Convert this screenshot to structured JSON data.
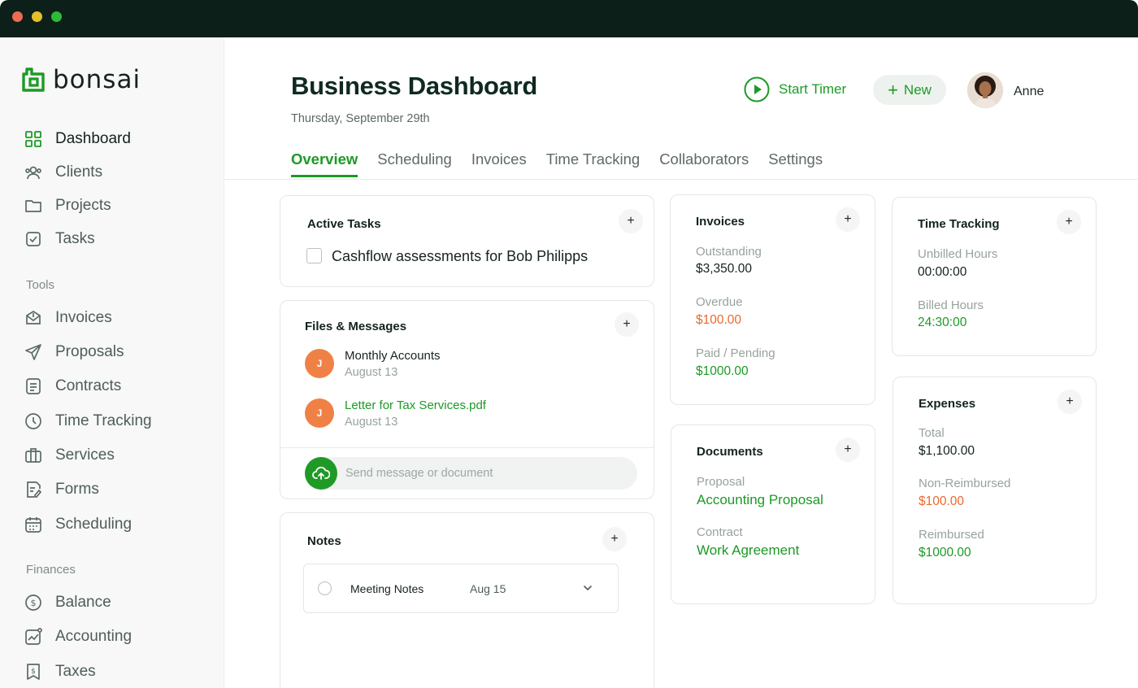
{
  "app": {
    "logo_text": "bonsai"
  },
  "sidebar": {
    "main_items": [
      {
        "label": "Dashboard",
        "icon": "grid-icon",
        "active": true
      },
      {
        "label": "Clients",
        "icon": "users-icon"
      },
      {
        "label": "Projects",
        "icon": "folder-icon"
      },
      {
        "label": "Tasks",
        "icon": "check-square-icon"
      }
    ],
    "tools_label": "Tools",
    "tools_items": [
      {
        "label": "Invoices",
        "icon": "invoice-icon"
      },
      {
        "label": "Proposals",
        "icon": "send-icon"
      },
      {
        "label": "Contracts",
        "icon": "document-icon"
      },
      {
        "label": "Time Tracking",
        "icon": "clock-icon"
      },
      {
        "label": "Services",
        "icon": "briefcase-icon"
      },
      {
        "label": "Forms",
        "icon": "form-icon"
      },
      {
        "label": "Scheduling",
        "icon": "calendar-icon"
      }
    ],
    "finances_label": "Finances",
    "finances_items": [
      {
        "label": "Balance",
        "icon": "dollar-circle-icon"
      },
      {
        "label": "Accounting",
        "icon": "chart-icon"
      },
      {
        "label": "Taxes",
        "icon": "tax-icon"
      }
    ]
  },
  "header": {
    "title": "Business Dashboard",
    "date": "Thursday, September 29th",
    "start_timer_label": "Start Timer",
    "new_label": "New",
    "user_name": "Anne"
  },
  "tabs": [
    {
      "label": "Overview",
      "active": true
    },
    {
      "label": "Scheduling"
    },
    {
      "label": "Invoices"
    },
    {
      "label": "Time Tracking"
    },
    {
      "label": "Collaborators"
    },
    {
      "label": "Settings"
    }
  ],
  "active_tasks": {
    "title": "Active Tasks",
    "tasks": [
      {
        "text": "Cashflow assessments for Bob Philipps",
        "checked": false
      }
    ]
  },
  "files_messages": {
    "title": "Files & Messages",
    "items": [
      {
        "initial": "J",
        "name": "Monthly Accounts",
        "date": "August 13",
        "is_link": false
      },
      {
        "initial": "J",
        "name": "Letter for Tax Services.pdf",
        "date": "August 13",
        "is_link": true
      }
    ],
    "input_placeholder": "Send message or document"
  },
  "notes": {
    "title": "Notes",
    "items": [
      {
        "title": "Meeting Notes",
        "date": "Aug 15"
      }
    ]
  },
  "invoices": {
    "title": "Invoices",
    "outstanding_label": "Outstanding",
    "outstanding_value": "$3,350.00",
    "overdue_label": "Overdue",
    "overdue_value": "$100.00",
    "paid_label": "Paid / Pending",
    "paid_value": "$1000.00"
  },
  "documents": {
    "title": "Documents",
    "proposal_label": "Proposal",
    "proposal_value": "Accounting Proposal",
    "contract_label": "Contract",
    "contract_value": "Work Agreement"
  },
  "time_tracking": {
    "title": "Time Tracking",
    "unbilled_label": "Unbilled Hours",
    "unbilled_value": "00:00:00",
    "billed_label": "Billed Hours",
    "billed_value": "24:30:00"
  },
  "expenses": {
    "title": "Expenses",
    "total_label": "Total",
    "total_value": "$1,100.00",
    "non_reimbursed_label": "Non-Reimbursed",
    "non_reimbursed_value": "$100.00",
    "reimbursed_label": "Reimbursed",
    "reimbursed_value": "$1000.00"
  },
  "colors": {
    "brand_green": "#1c9a26",
    "alert_orange": "#ea6a2c",
    "titlebar": "#0d1f19"
  }
}
